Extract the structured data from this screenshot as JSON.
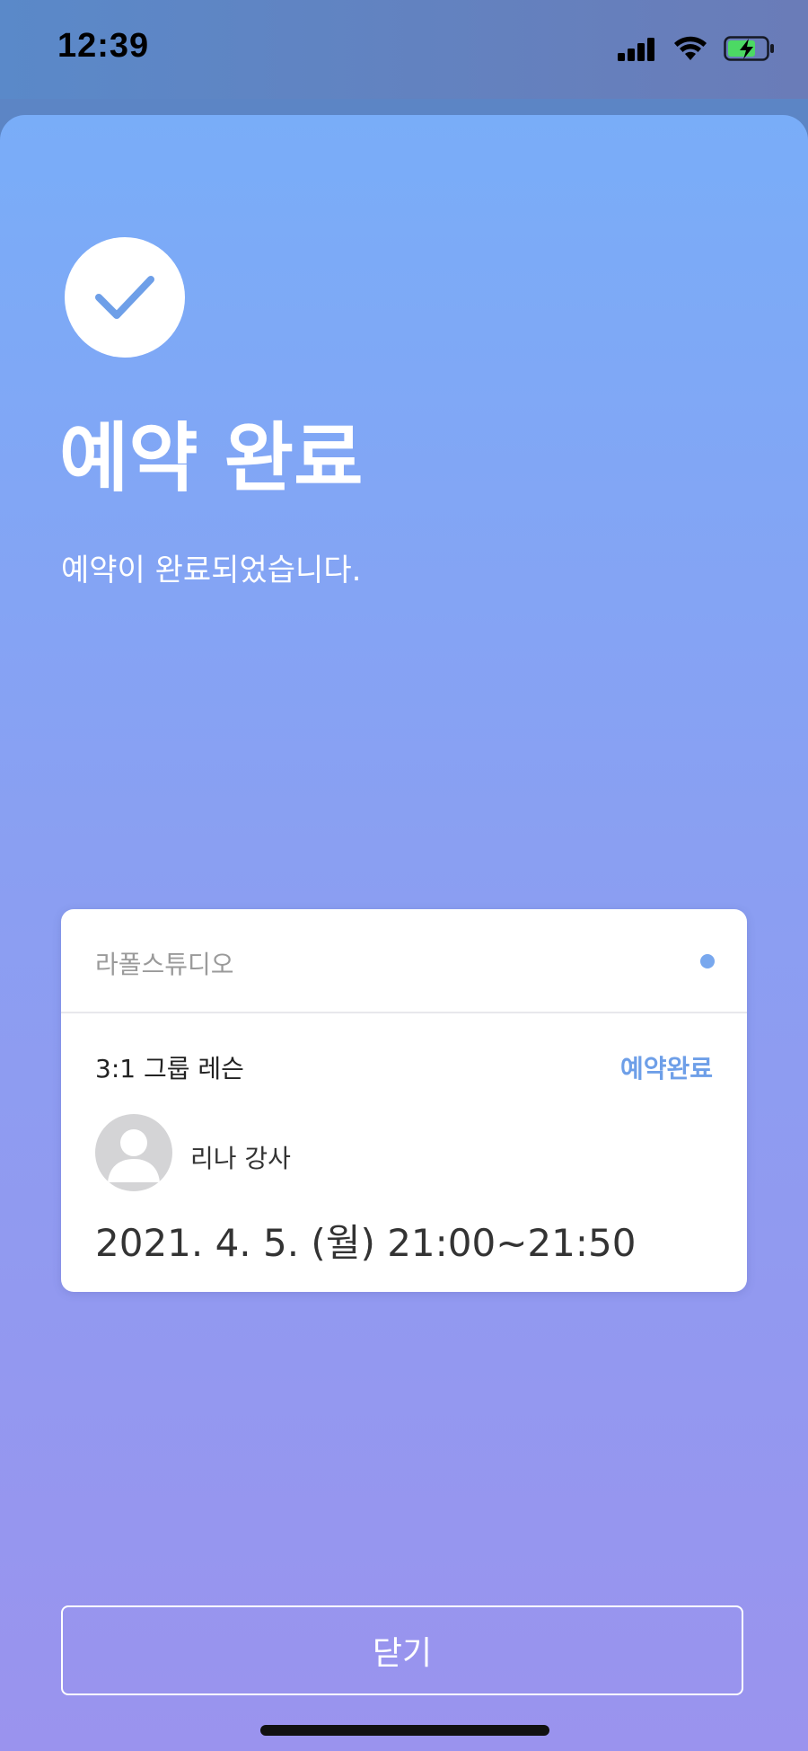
{
  "status_bar": {
    "time": "12:39",
    "icons": [
      "signal-icon",
      "wifi-icon",
      "battery-charging-icon"
    ]
  },
  "confirmation": {
    "icon": "check-icon",
    "title": "예약 완료",
    "message": "예약이 완료되었습니다."
  },
  "booking": {
    "studio": "라폴스튜디오",
    "lesson": "3:1 그룹 레슨",
    "status": "예약완료",
    "teacher": "리나 강사",
    "datetime": "2021. 4. 5. (월) 21:00~21:50"
  },
  "actions": {
    "close_label": "닫기"
  },
  "colors": {
    "accent": "#6e9fe8",
    "gradient_top": "#79adf8",
    "gradient_bottom": "#9a93ee",
    "battery_fill": "#4cd964"
  }
}
